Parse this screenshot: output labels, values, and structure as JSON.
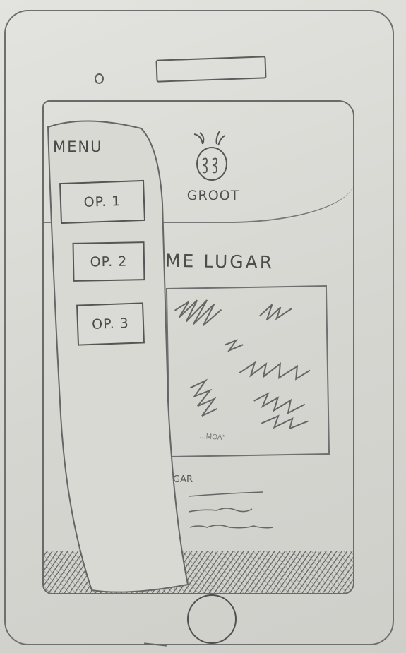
{
  "app": {
    "logo_text": "GROOT",
    "page_title": "ME LUGAR"
  },
  "menu": {
    "title": "MENU",
    "options": [
      {
        "label": "OP. 1"
      },
      {
        "label": "OP. 2"
      },
      {
        "label": "OP. 3"
      }
    ]
  },
  "content": {
    "photo_caption": "...MOA\"",
    "section_label": "GAR"
  },
  "colors": {
    "pencil": "#4a4a4a",
    "paper": "#dcdcd7"
  },
  "icons": {
    "logo": "groot-head-icon",
    "home": "home-button-icon"
  }
}
